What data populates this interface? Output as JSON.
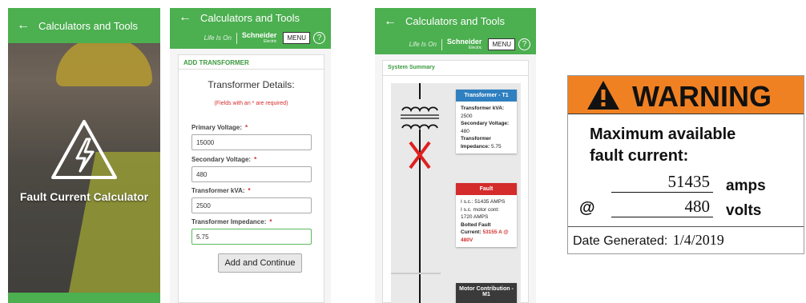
{
  "app": {
    "title": "Calculators and Tools"
  },
  "brand": {
    "tagline": "Life Is On",
    "company": "Schneider",
    "sub": "Electric",
    "menu_label": "MENU",
    "help_label": "?"
  },
  "splash": {
    "title": "Fault Current Calculator"
  },
  "transformer_form": {
    "section": "ADD TRANSFORMER",
    "heading": "Transformer Details:",
    "required_note": "(Fields with an * are required)",
    "fields": [
      {
        "label": "Primary Voltage:",
        "value": "15000"
      },
      {
        "label": "Secondary Voltage:",
        "value": "480"
      },
      {
        "label": "Transformer kVA:",
        "value": "2500"
      },
      {
        "label": "Transformer Impedance:",
        "value": "5.75"
      }
    ],
    "required_mark": "*",
    "submit_label": "Add and Continue"
  },
  "summary": {
    "section": "System Summary",
    "transformer": {
      "header": "Transformer - T1",
      "kva_label": "Transformer kVA:",
      "kva_value": "2500",
      "sec_label": "Secondary Voltage:",
      "sec_value": "480",
      "imp_label": "Transformer Impedance:",
      "imp_value": "5.75",
      "color": "#2f80c0"
    },
    "fault": {
      "header": "Fault",
      "isc_label": "I s.c.:",
      "isc_value": "51435 AMPS",
      "motor_label": "I s.c. motor cont:",
      "motor_value": "1720 AMPS",
      "bolted_label": "Bolted Fault Current:",
      "bolted_value": "53155 A @ 480V",
      "color": "#d42b2b"
    },
    "motor": {
      "header": "Motor Contribution - M1",
      "color": "#3a3a3a"
    }
  },
  "warning_label": {
    "header": "WARNING",
    "line1": "Maximum available",
    "line2": "fault current:",
    "amps_value": "51435",
    "amps_unit": "amps",
    "at": "@",
    "volts_value": "480",
    "volts_unit": "volts",
    "date_label": "Date Generated:",
    "date_value": "1/4/2019",
    "header_color": "#f08123"
  }
}
